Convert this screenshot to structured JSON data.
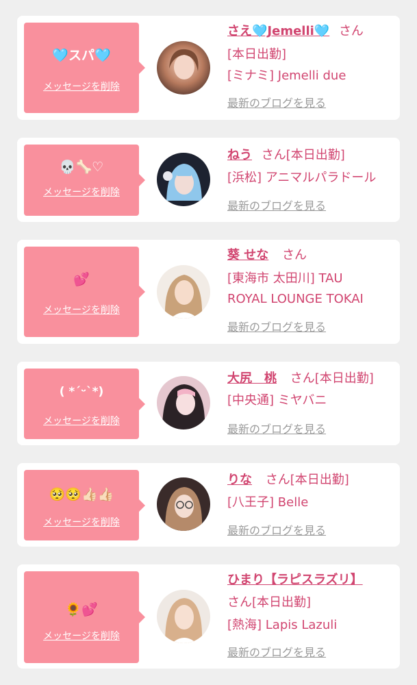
{
  "colors": {
    "page_background": "#efefef",
    "card_background": "#ffffff",
    "bubble_pink": "#f9909d",
    "name_pink": "#d14570",
    "link_gray": "#9a9a9a"
  },
  "common": {
    "delete_label": "メッセージを削除",
    "blog_label": "最新のブログを見る",
    "san": "さん"
  },
  "entries": [
    {
      "message": "🩵スパ🩵",
      "name": "さえ🩵Jemelli🩵",
      "status": "[本日出勤]",
      "shop": "[ミナミ] Jemelli due",
      "avatar_icon": "avatar-photo"
    },
    {
      "message": "💀🦴♡",
      "name": "ねう",
      "status": "[本日出勤]",
      "shop": "[浜松] アニマルパラドール",
      "avatar_icon": "avatar-photo"
    },
    {
      "message": "💕",
      "name": "葵 せな",
      "status": "",
      "shop": "[東海市 太田川] TAU",
      "shop_line2": "ROYAL LOUNGE TOKAI",
      "avatar_icon": "avatar-photo"
    },
    {
      "message": "( *´ᵕ`*)",
      "name": "大尻　桃",
      "status": "[本日出勤]",
      "shop": "[中央通] ミヤバニ",
      "avatar_icon": "avatar-photo"
    },
    {
      "message": "🥺🥺👍🏻👍🏻",
      "name": "りな",
      "status": "[本日出勤]",
      "shop": "[八王子] Belle",
      "avatar_icon": "avatar-photo"
    },
    {
      "message": "🌻💕",
      "name": "ひまり【ラピスラズリ】",
      "status": "[本日出勤]",
      "shop": "[熱海] Lapis Lazuli",
      "avatar_icon": "avatar-photo"
    }
  ]
}
